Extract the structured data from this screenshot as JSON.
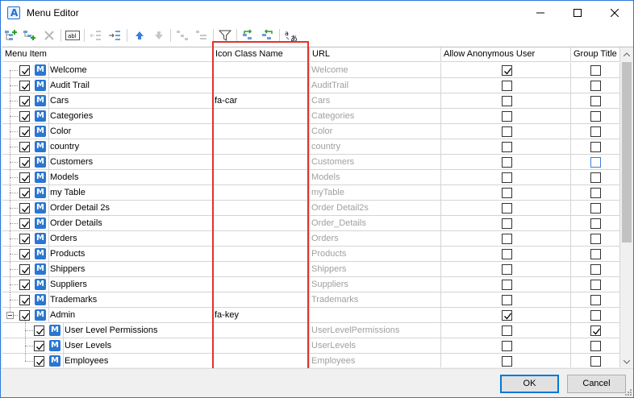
{
  "window": {
    "title": "Menu Editor"
  },
  "columns": {
    "menu_item": "Menu Item",
    "icon_class": "Icon Class Name",
    "url": "URL",
    "allow_anonymous": "Allow Anonymous User",
    "group_title": "Group Title"
  },
  "rows": [
    {
      "name": "Welcome",
      "icon": "",
      "url": "Welcome",
      "anon": true,
      "group": false,
      "level": 0
    },
    {
      "name": "Audit Trail",
      "icon": "",
      "url": "AuditTrail",
      "anon": false,
      "group": false,
      "level": 0
    },
    {
      "name": "Cars",
      "icon": "fa-car",
      "url": "Cars",
      "anon": false,
      "group": false,
      "level": 0
    },
    {
      "name": "Categories",
      "icon": "",
      "url": "Categories",
      "anon": false,
      "group": false,
      "level": 0
    },
    {
      "name": "Color",
      "icon": "",
      "url": "Color",
      "anon": false,
      "group": false,
      "level": 0
    },
    {
      "name": "country",
      "icon": "",
      "url": "country",
      "anon": false,
      "group": false,
      "level": 0
    },
    {
      "name": "Customers",
      "icon": "",
      "url": "Customers",
      "anon": false,
      "group": false,
      "level": 0,
      "group_focus": true
    },
    {
      "name": "Models",
      "icon": "",
      "url": "Models",
      "anon": false,
      "group": false,
      "level": 0
    },
    {
      "name": "my Table",
      "icon": "",
      "url": "myTable",
      "anon": false,
      "group": false,
      "level": 0
    },
    {
      "name": "Order Detail 2s",
      "icon": "",
      "url": "Order Detail2s",
      "anon": false,
      "group": false,
      "level": 0
    },
    {
      "name": "Order Details",
      "icon": "",
      "url": "Order_Details",
      "anon": false,
      "group": false,
      "level": 0
    },
    {
      "name": "Orders",
      "icon": "",
      "url": "Orders",
      "anon": false,
      "group": false,
      "level": 0
    },
    {
      "name": "Products",
      "icon": "",
      "url": "Products",
      "anon": false,
      "group": false,
      "level": 0
    },
    {
      "name": "Shippers",
      "icon": "",
      "url": "Shippers",
      "anon": false,
      "group": false,
      "level": 0
    },
    {
      "name": "Suppliers",
      "icon": "",
      "url": "Suppliers",
      "anon": false,
      "group": false,
      "level": 0
    },
    {
      "name": "Trademarks",
      "icon": "",
      "url": "Trademarks",
      "anon": false,
      "group": false,
      "level": 0
    },
    {
      "name": "Admin",
      "icon": "fa-key",
      "url": "",
      "anon": true,
      "group": false,
      "level": 0,
      "expanded": true
    },
    {
      "name": "User Level Permissions",
      "icon": "",
      "url": "UserLevelPermissions",
      "anon": false,
      "group": true,
      "level": 1
    },
    {
      "name": "User Levels",
      "icon": "",
      "url": "UserLevels",
      "anon": false,
      "group": false,
      "level": 1
    },
    {
      "name": "Employees",
      "icon": "",
      "url": "Employees",
      "anon": false,
      "group": false,
      "level": 1
    }
  ],
  "menu_icon_letter": "M",
  "buttons": {
    "ok": "OK",
    "cancel": "Cancel"
  },
  "colors": {
    "accent": "#2a76d2",
    "highlight": "#e2332a",
    "url_text": "#a0a0a0"
  }
}
